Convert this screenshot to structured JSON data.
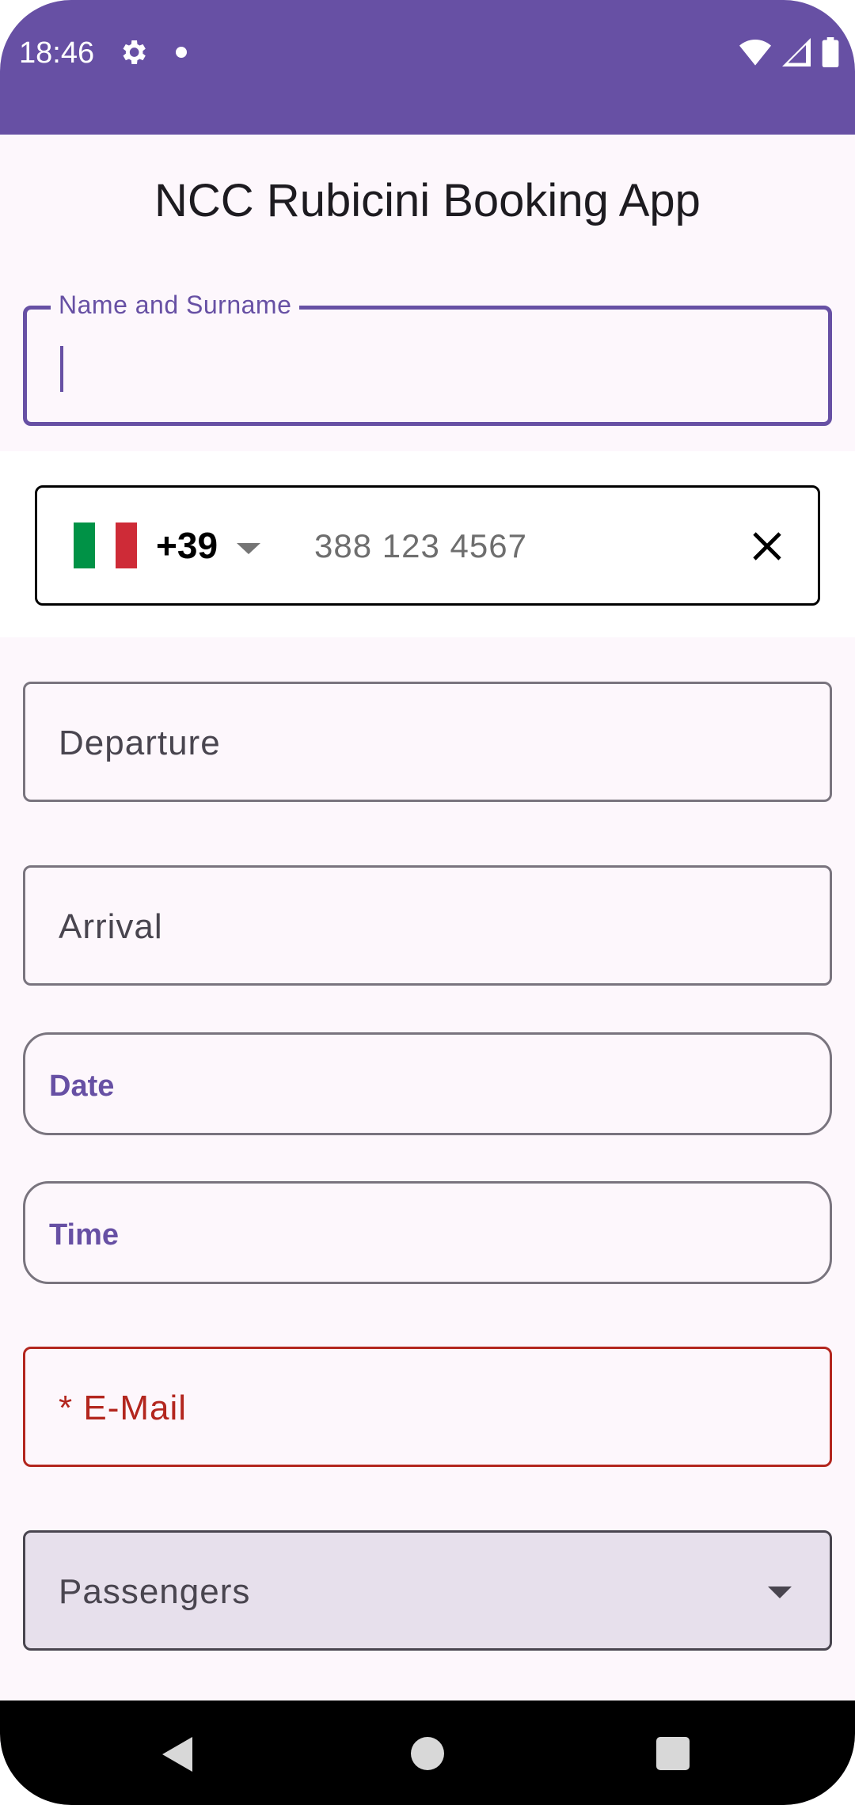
{
  "status_bar": {
    "time": "18:46",
    "icons": [
      "settings-icon",
      "notification-dot-icon",
      "wifi-icon",
      "signal-icon",
      "battery-icon"
    ]
  },
  "app": {
    "title": "NCC Rubicini Booking App"
  },
  "form": {
    "name": {
      "label": "Name and Surname",
      "value": ""
    },
    "phone": {
      "country": "Italy",
      "country_code": "+39",
      "placeholder": "388 123 4567",
      "clear_icon": "close-icon"
    },
    "departure": {
      "placeholder": "Departure"
    },
    "arrival": {
      "placeholder": "Arrival"
    },
    "date": {
      "label": "Date"
    },
    "time": {
      "label": "Time"
    },
    "email": {
      "placeholder": "* E-Mail"
    },
    "passengers": {
      "placeholder": "Passengers"
    }
  },
  "nav_bar": {
    "icons": [
      "back-icon",
      "home-icon",
      "recents-icon"
    ]
  },
  "colors": {
    "primary": "#6750a4",
    "error": "#b3261e",
    "background": "#fdf7fc",
    "flag": [
      "#009246",
      "#ffffff",
      "#ce2b37"
    ]
  }
}
